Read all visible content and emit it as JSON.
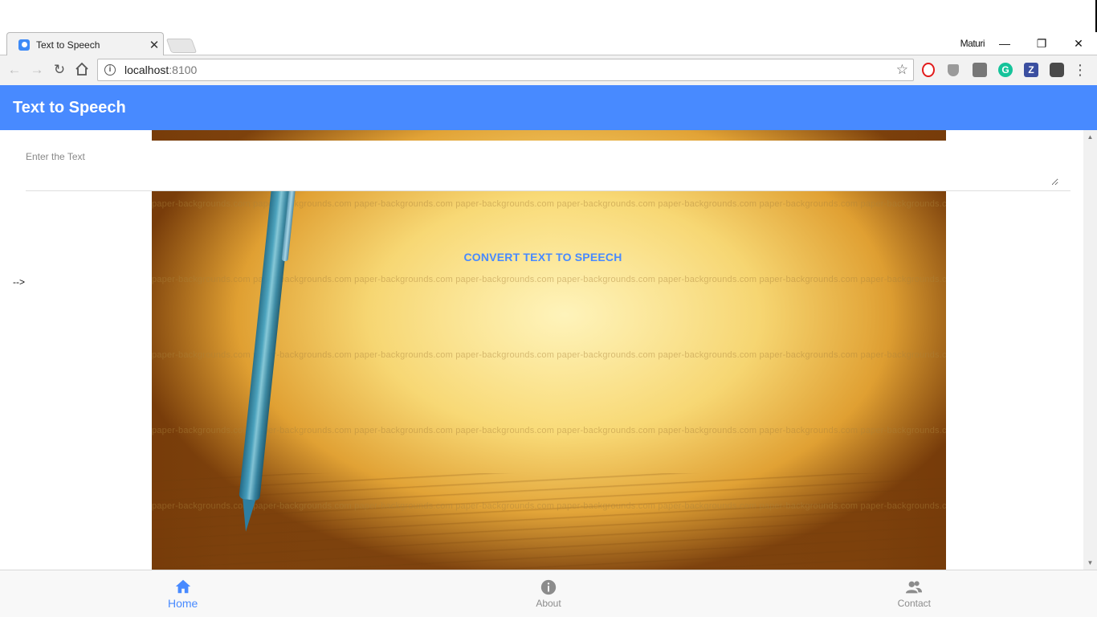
{
  "browser": {
    "tab_title": "Text to Speech",
    "tab_close": "✕",
    "profile_name": "Maturi",
    "url_host": "localhost",
    "url_port": ":8100",
    "window_controls": {
      "minimize": "—",
      "restore": "❐",
      "close": "✕"
    }
  },
  "header": {
    "title": "Text to Speech"
  },
  "form": {
    "label": "Enter the Text",
    "value": ""
  },
  "content": {
    "convert_button": "CONVERT TEXT TO SPEECH",
    "stray_text": "-->",
    "watermark": "paper-backgrounds.com   paper-backgrounds.com   paper-backgrounds.com   paper-backgrounds.com   paper-backgrounds.com   paper-backgrounds.com   paper-backgrounds.com   paper-backgrounds.com"
  },
  "tabs": [
    {
      "label": "Home",
      "icon": "home-icon",
      "active": true
    },
    {
      "label": "About",
      "icon": "info-icon",
      "active": false
    },
    {
      "label": "Contact",
      "icon": "contacts-icon",
      "active": false
    }
  ],
  "colors": {
    "primary": "#488aff",
    "tab_inactive": "#8c8c8c"
  }
}
